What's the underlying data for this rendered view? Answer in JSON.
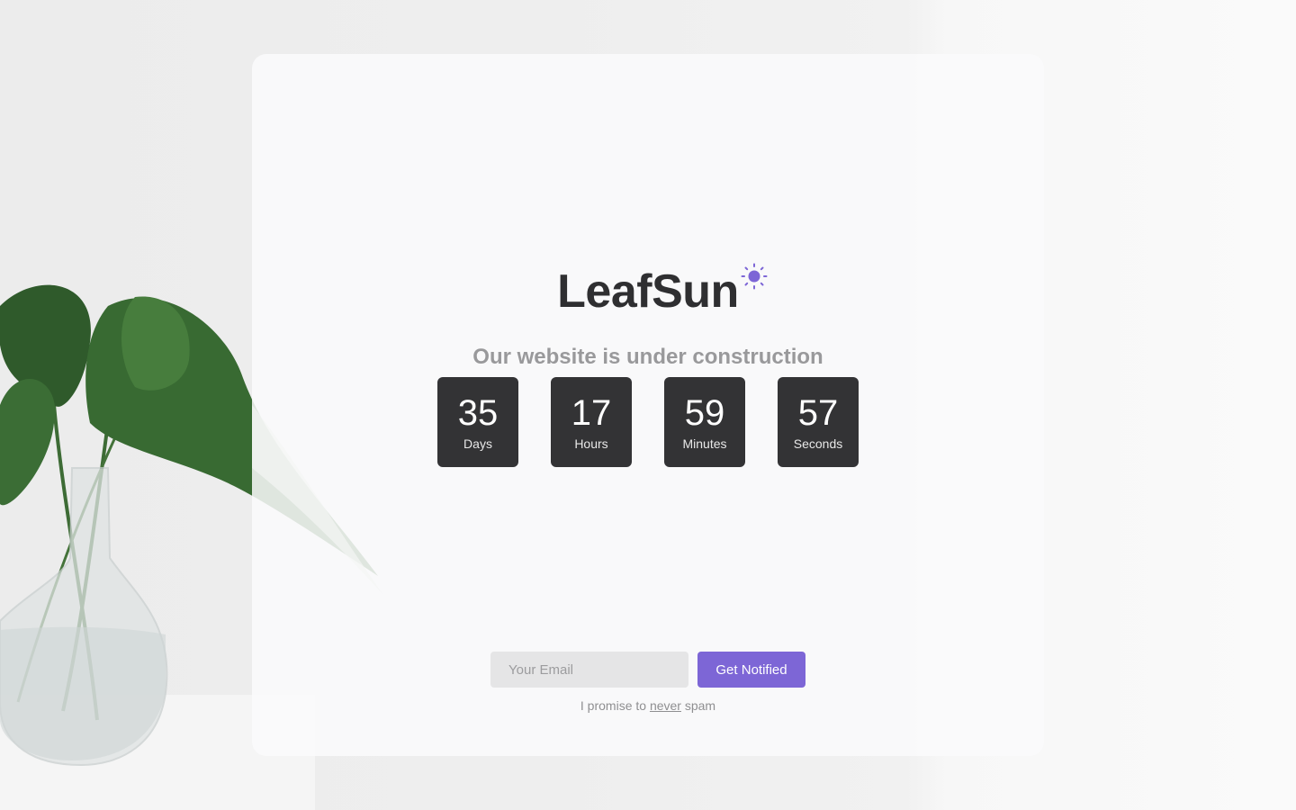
{
  "brand": {
    "name": "LeafSun",
    "accent_color": "#7d66d6",
    "logo_icon": "sun-icon"
  },
  "tagline": "Our website is under construction",
  "countdown": [
    {
      "value": "35",
      "label": "Days"
    },
    {
      "value": "17",
      "label": "Hours"
    },
    {
      "value": "59",
      "label": "Minutes"
    },
    {
      "value": "57",
      "label": "Seconds"
    }
  ],
  "signup": {
    "email_placeholder": "Your Email",
    "email_value": "",
    "button_label": "Get Notified"
  },
  "footnote": {
    "before": "I promise to",
    "emphasis": "never",
    "after": "spam"
  },
  "colors": {
    "countdown_box": "#333335",
    "card_background": "#fafafb"
  }
}
